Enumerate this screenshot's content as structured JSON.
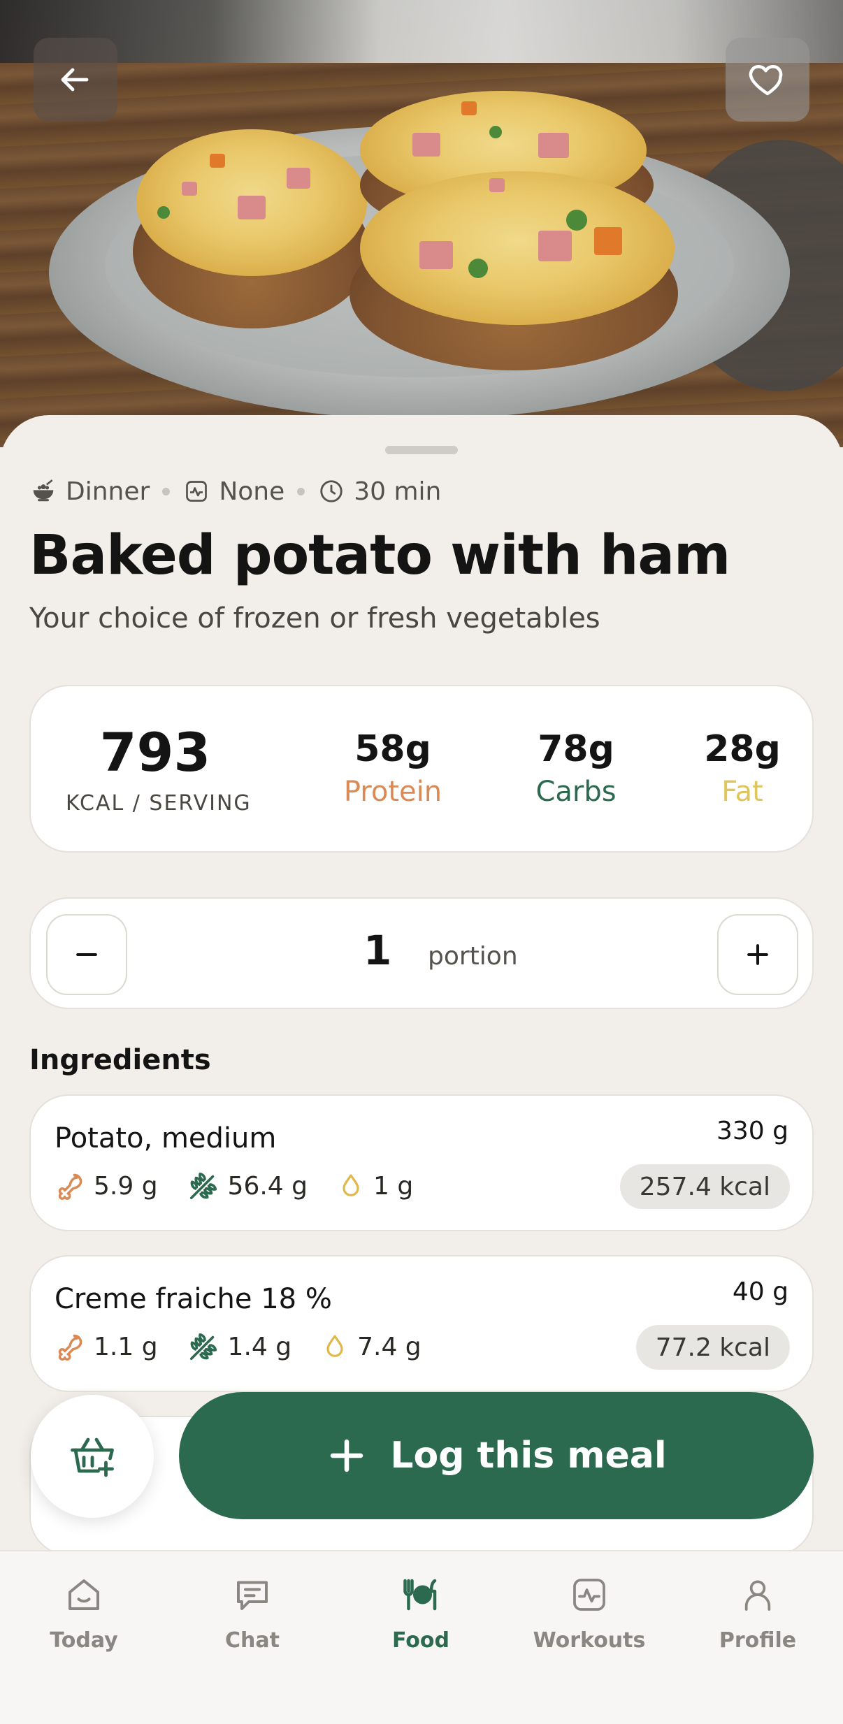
{
  "header": {
    "back_label": "back",
    "favorite_label": "favorite"
  },
  "meta": {
    "meal_type": "Dinner",
    "activity": "None",
    "duration": "30 min"
  },
  "recipe": {
    "title": "Baked potato with ham",
    "subtitle": "Your choice of frozen or fresh vegetables"
  },
  "nutrition": {
    "kcal": "793",
    "kcal_label": "KCAL / SERVING",
    "protein": {
      "value": "58g",
      "label": "Protein",
      "color": "#d98a55"
    },
    "carbs": {
      "value": "78g",
      "label": "Carbs",
      "color": "#2b6a4f"
    },
    "fat": {
      "value": "28g",
      "label": "Fat",
      "color": "#e0c65a"
    }
  },
  "portion": {
    "count": "1",
    "label": "portion"
  },
  "ingredients": {
    "heading": "Ingredients",
    "items": [
      {
        "name": "Potato, medium",
        "weight": "330 g",
        "protein": "5.9 g",
        "carbs": "56.4 g",
        "fat": "1 g",
        "kcal": "257.4 kcal"
      },
      {
        "name": "Creme fraiche 18 %",
        "weight": "40 g",
        "protein": "1.1 g",
        "carbs": "1.4 g",
        "fat": "7.4 g",
        "kcal": "77.2 kcal"
      }
    ]
  },
  "actions": {
    "log_label": "Log this meal"
  },
  "nav": {
    "items": [
      {
        "label": "Today",
        "icon": "home-icon"
      },
      {
        "label": "Chat",
        "icon": "chat-icon"
      },
      {
        "label": "Food",
        "icon": "food-icon",
        "active": true
      },
      {
        "label": "Workouts",
        "icon": "activity-icon"
      },
      {
        "label": "Profile",
        "icon": "profile-icon"
      }
    ]
  },
  "colors": {
    "accent": "#2b6a4f",
    "background": "#f2efea"
  }
}
